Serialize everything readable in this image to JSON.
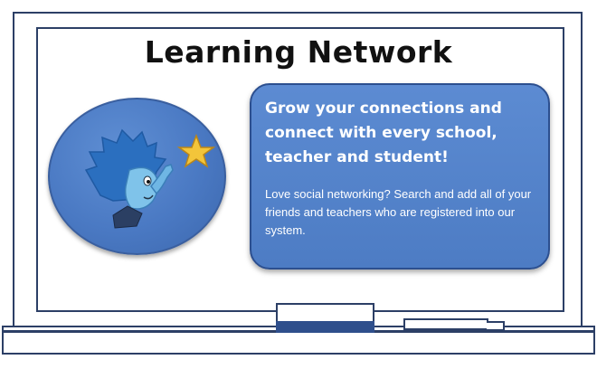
{
  "page": {
    "title": "Learning Network"
  },
  "feature_card": {
    "heading": "Grow your connections and connect with every school, teacher and student!",
    "body": "Love social networking? Search and add all of your friends and teachers who are registered into our system."
  },
  "illustration": {
    "icon": "child-reaching-for-star-icon",
    "star_color": "#f3c53a",
    "character_color": "#3f7fd0"
  },
  "colors": {
    "board_outline": "#2c3f66",
    "card_fill": "#5584cb",
    "text_on_card": "#ffffff"
  }
}
